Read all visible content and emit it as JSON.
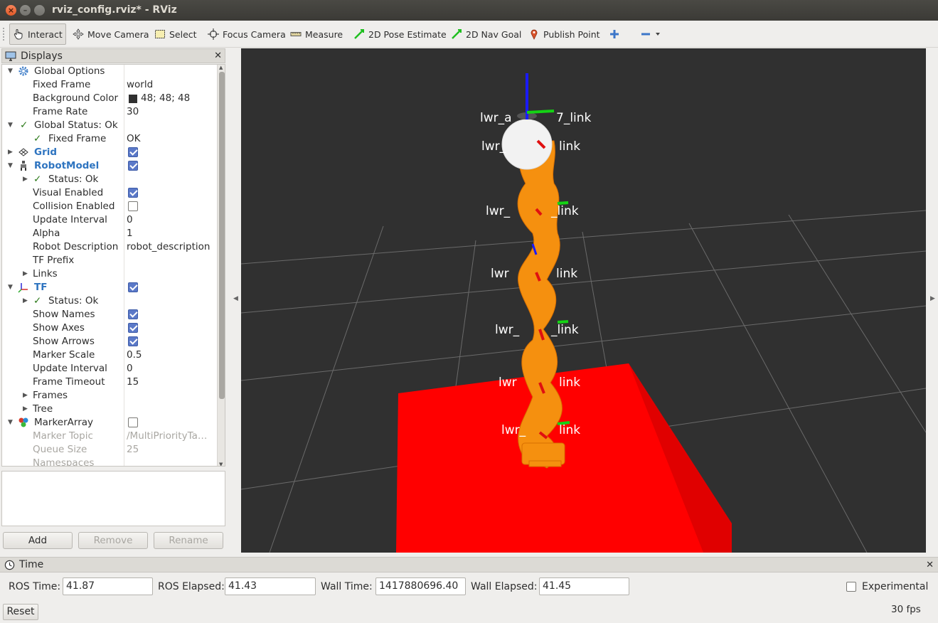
{
  "window": {
    "title": "rviz_config.rviz* - RViz"
  },
  "toolbar": {
    "interact": "Interact",
    "move_camera": "Move Camera",
    "select": "Select",
    "focus_camera": "Focus Camera",
    "measure": "Measure",
    "pose_estimate": "2D Pose Estimate",
    "nav_goal": "2D Nav Goal",
    "publish_point": "Publish Point"
  },
  "displays": {
    "title": "Displays",
    "rows": [
      {
        "name": "Global Options",
        "value": ""
      },
      {
        "name": "Fixed Frame",
        "value": "world"
      },
      {
        "name": "Background Color",
        "value": "48; 48; 48"
      },
      {
        "name": "Frame Rate",
        "value": "30"
      },
      {
        "name": "Global Status: Ok",
        "value": ""
      },
      {
        "name": "Fixed Frame",
        "value": "OK"
      },
      {
        "name": "Grid",
        "value": ""
      },
      {
        "name": "RobotModel",
        "value": ""
      },
      {
        "name": "Status: Ok",
        "value": ""
      },
      {
        "name": "Visual Enabled",
        "value": ""
      },
      {
        "name": "Collision Enabled",
        "value": ""
      },
      {
        "name": "Update Interval",
        "value": "0"
      },
      {
        "name": "Alpha",
        "value": "1"
      },
      {
        "name": "Robot Description",
        "value": "robot_description"
      },
      {
        "name": "TF Prefix",
        "value": ""
      },
      {
        "name": "Links",
        "value": ""
      },
      {
        "name": "TF",
        "value": ""
      },
      {
        "name": "Status: Ok",
        "value": ""
      },
      {
        "name": "Show Names",
        "value": ""
      },
      {
        "name": "Show Axes",
        "value": ""
      },
      {
        "name": "Show Arrows",
        "value": ""
      },
      {
        "name": "Marker Scale",
        "value": "0.5"
      },
      {
        "name": "Update Interval",
        "value": "0"
      },
      {
        "name": "Frame Timeout",
        "value": "15"
      },
      {
        "name": "Frames",
        "value": ""
      },
      {
        "name": "Tree",
        "value": ""
      },
      {
        "name": "MarkerArray",
        "value": ""
      },
      {
        "name": "Marker Topic",
        "value": "/MultiPriorityTa…"
      },
      {
        "name": "Queue Size",
        "value": "25"
      },
      {
        "name": "Namespaces",
        "value": ""
      }
    ],
    "background_color_hex": "#303030",
    "add": "Add",
    "remove": "Remove",
    "rename": "Rename"
  },
  "viewport": {
    "labels": [
      "lwr_a",
      "7_link",
      "lwr_",
      "link",
      "lwr_",
      "_link",
      "lwr",
      "link",
      "lwr_",
      "_link",
      "lwr",
      "link",
      "lwr_",
      "link"
    ]
  },
  "time": {
    "title": "Time",
    "ros_time_label": "ROS Time:",
    "ros_time": "41.87",
    "ros_elapsed_label": "ROS Elapsed:",
    "ros_elapsed": "41.43",
    "wall_time_label": "Wall Time:",
    "wall_time": "1417880696.40",
    "wall_elapsed_label": "Wall Elapsed:",
    "wall_elapsed": "41.45",
    "experimental": "Experimental"
  },
  "footer": {
    "reset": "Reset",
    "fps": "30 fps"
  },
  "colors": {
    "accent_blue": "#2e74c0",
    "robot_orange": "#f5900f",
    "box_red": "#ff0000"
  }
}
